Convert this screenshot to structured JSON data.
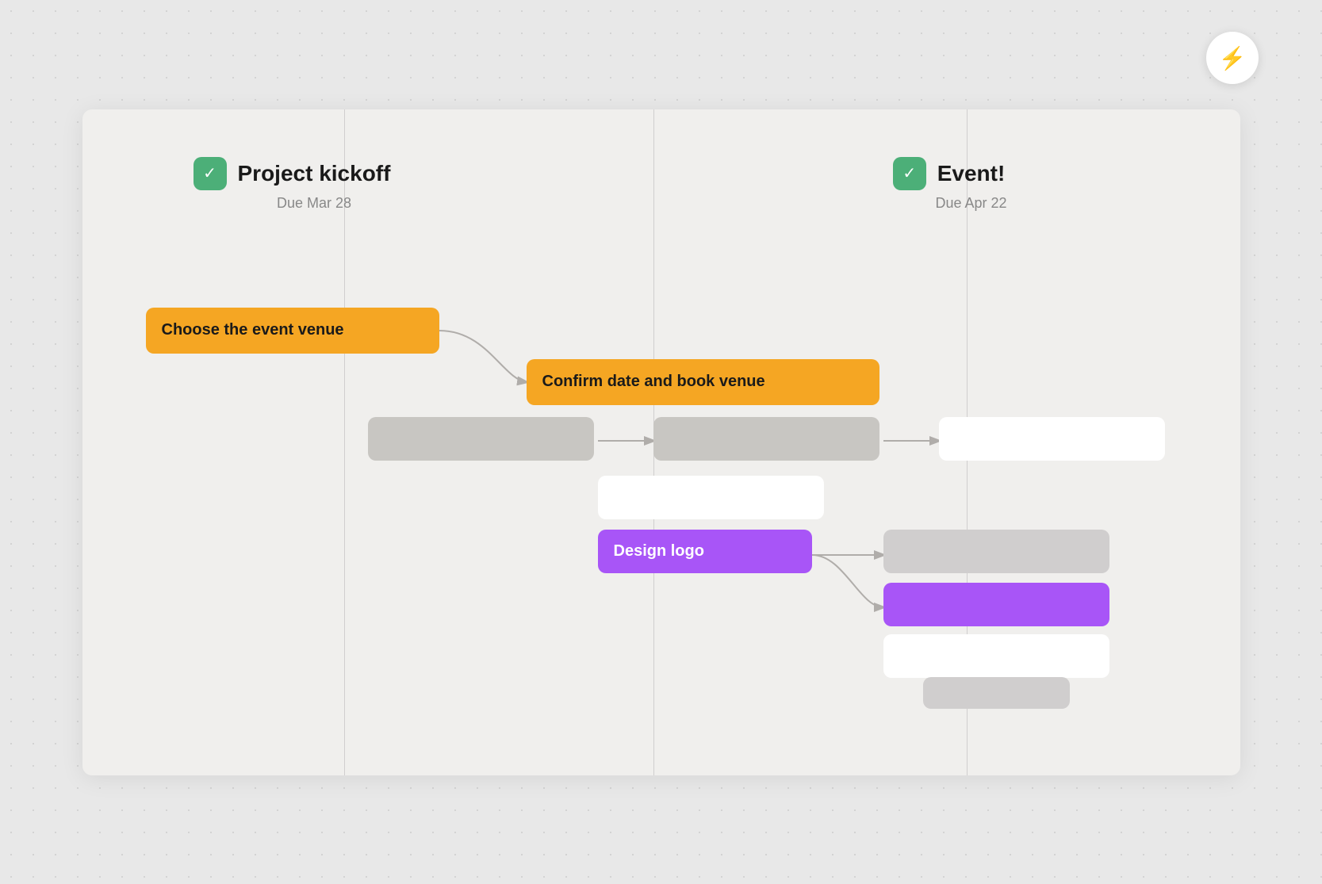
{
  "lightning": {
    "icon": "⚡"
  },
  "milestones": [
    {
      "id": "m1",
      "title": "Project kickoff",
      "due": "Due Mar 28",
      "icon": "✓"
    },
    {
      "id": "m2",
      "title": "Event!",
      "due": "Due Apr 22",
      "icon": "✓"
    }
  ],
  "tasks": [
    {
      "id": "t1",
      "label": "Choose the event venue",
      "type": "orange",
      "style": "left:80px; top:250px; width:370px;"
    },
    {
      "id": "t2",
      "label": "Confirm date and book venue",
      "type": "orange",
      "style": "left:560px; top:315px; width:440px;"
    },
    {
      "id": "t3",
      "label": "",
      "type": "gray",
      "style": "left:360px; top:390px; width:290px;"
    },
    {
      "id": "t4",
      "label": "",
      "type": "gray",
      "style": "left:720px; top:390px; width:290px;"
    },
    {
      "id": "t5",
      "label": "",
      "type": "white",
      "style": "left:1080px; top:390px; width:290px;"
    },
    {
      "id": "t6",
      "label": "",
      "type": "white",
      "style": "left:650px; top:465px; width:290px;"
    },
    {
      "id": "t7",
      "label": "Design logo",
      "type": "purple",
      "style": "left:650px; top:535px; width:270px;"
    },
    {
      "id": "t8",
      "label": "",
      "type": "gray-light",
      "style": "left:1010px; top:535px; width:290px;"
    },
    {
      "id": "t9",
      "label": "",
      "type": "purple",
      "style": "left:1010px; top:600px; width:290px;"
    },
    {
      "id": "t10",
      "label": "",
      "type": "white",
      "style": "left:1010px; top:668px; width:290px;"
    },
    {
      "id": "t11",
      "label": "",
      "type": "gray-light",
      "style": "left:1060px; top:720px; width:190px;"
    }
  ]
}
